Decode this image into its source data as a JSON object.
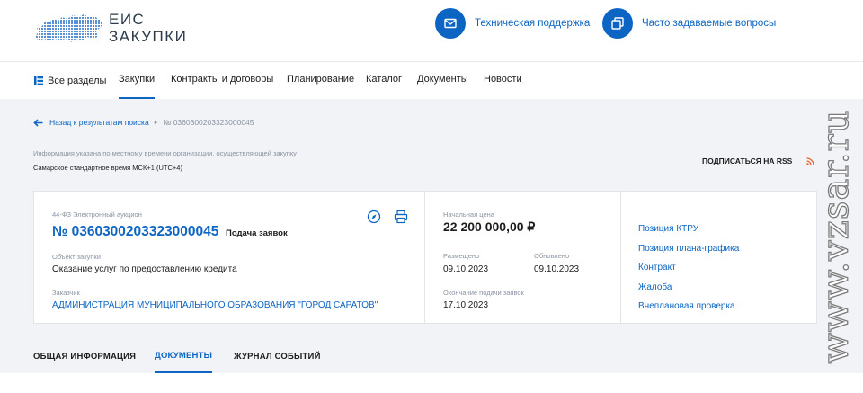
{
  "header": {
    "logo_line1": "ЕИС",
    "logo_line2": "ЗАКУПКИ",
    "support_label": "Техническая поддержка",
    "faq_label": "Часто задаваемые вопросы",
    "accent_color": "#0d65c3"
  },
  "nav": {
    "items": [
      "Все разделы",
      "Закупки",
      "Контракты и договоры",
      "Планирование",
      "Каталог",
      "Документы",
      "Новости"
    ],
    "active": "Закупки"
  },
  "breadcrumb": {
    "back_label": "Назад к результатам поиска",
    "separator": "▸",
    "current": "№ 0360300203323000045"
  },
  "timezone": {
    "info": "Информация указана по местному времени организации, осуществляющей закупку",
    "value": "Самарское стандартное время МСК+1 (UTC+4)"
  },
  "rss_label": "ПОДПИСАТЬСЯ НА RSS",
  "purchase": {
    "type": "44-ФЗ Электронный аукцион",
    "number": "№ 0360300203323000045",
    "stage": "Подача заявок",
    "object_label": "Объект закупки",
    "object_value": "Оказание услуг по предоставлению кредита",
    "customer_label": "Заказчик",
    "customer_value": "АДМИНИСТРАЦИЯ МУНИЦИПАЛЬНОГО ОБРАЗОВАНИЯ \"ГОРОД САРАТОВ\"",
    "price_label": "Начальная цена",
    "price_value": "22 200 000,00 ₽",
    "posted_label": "Размещено",
    "posted_value": "09.10.2023",
    "updated_label": "Обновлено",
    "updated_value": "09.10.2023",
    "deadline_label": "Окончание подачи заявок",
    "deadline_value": "17.10.2023"
  },
  "related_links": [
    "Позиция КТРУ",
    "Позиция плана-графика",
    "Контракт",
    "Жалоба",
    "Внеплановая проверка"
  ],
  "tabs": {
    "items": [
      "ОБЩАЯ ИНФОРМАЦИЯ",
      "ДОКУМЕНТЫ",
      "ЖУРНАЛ СОБЫТИЙ"
    ],
    "active": "ДОКУМЕНТЫ"
  },
  "watermark": "www.vzsar.ru"
}
